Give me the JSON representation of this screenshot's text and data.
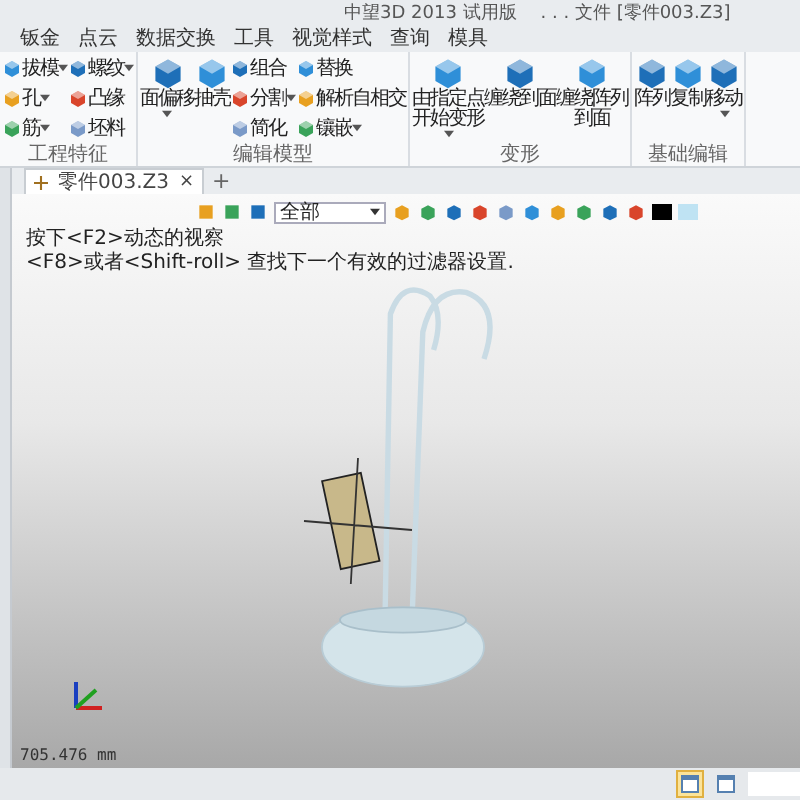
{
  "window": {
    "title": "中望3D 2013 试用版",
    "document": ". . . 文件 [零件003.Z3]"
  },
  "menu": [
    "钣金",
    "点云",
    "数据交换",
    "工具",
    "视觉样式",
    "查询",
    "模具"
  ],
  "ribbon": [
    {
      "label": "工程特征",
      "columns": [
        {
          "kind": "small",
          "items": [
            {
              "label": "拔模",
              "dropdown": true
            },
            {
              "label": "孔",
              "dropdown": true
            },
            {
              "label": "筋",
              "dropdown": true
            }
          ]
        },
        {
          "kind": "small",
          "items": [
            {
              "label": "螺纹",
              "dropdown": true
            },
            {
              "label": "凸缘",
              "dropdown": false
            },
            {
              "label": "坯料",
              "dropdown": false
            }
          ]
        }
      ]
    },
    {
      "label": "编辑模型",
      "columns": [
        {
          "kind": "large",
          "items": [
            {
              "label": "面偏移",
              "dropdown": true
            }
          ]
        },
        {
          "kind": "large",
          "items": [
            {
              "label": "抽壳",
              "dropdown": false
            }
          ]
        },
        {
          "kind": "small",
          "items": [
            {
              "label": "组合",
              "dropdown": false
            },
            {
              "label": "分割",
              "dropdown": true
            },
            {
              "label": "简化",
              "dropdown": false
            }
          ]
        },
        {
          "kind": "small",
          "items": [
            {
              "label": "替换",
              "dropdown": false
            },
            {
              "label": "解析自相交",
              "dropdown": false
            },
            {
              "label": "镶嵌",
              "dropdown": true
            }
          ]
        }
      ]
    },
    {
      "label": "变形",
      "columns": [
        {
          "kind": "large",
          "items": [
            {
              "label": "由指定点开始变形",
              "dropdown": true
            }
          ]
        },
        {
          "kind": "large",
          "items": [
            {
              "label": "缠绕到面",
              "dropdown": false
            }
          ]
        },
        {
          "kind": "large",
          "items": [
            {
              "label": "缠绕阵列到面",
              "dropdown": false
            }
          ]
        }
      ]
    },
    {
      "label": "基础编辑",
      "columns": [
        {
          "kind": "large",
          "items": [
            {
              "label": "阵列",
              "dropdown": false
            }
          ]
        },
        {
          "kind": "large",
          "items": [
            {
              "label": "复制",
              "dropdown": false
            }
          ]
        },
        {
          "kind": "large",
          "items": [
            {
              "label": "移动",
              "dropdown": true
            }
          ]
        }
      ]
    }
  ],
  "tabs": [
    {
      "label": "零件003.Z3",
      "selected": true,
      "close": "×"
    }
  ],
  "new_tab": "+",
  "filter": {
    "value": "全部"
  },
  "hints": [
    "按下<F2>动态的视察",
    "<F8>或者<Shift-roll> 查找下一个有效的过滤器设置."
  ],
  "readout": "705.476 mm",
  "status_buttons": [
    {
      "selected": true
    },
    {
      "selected": false
    }
  ]
}
